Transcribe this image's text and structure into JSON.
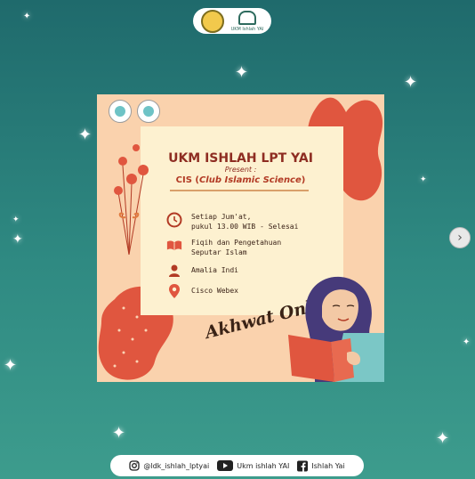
{
  "poster": {
    "title": "UKM ISHLAH LPT YAI",
    "present": "Present :",
    "cis_prefix": "CIS (",
    "cis_italic": "Club Islamic Science",
    "cis_suffix": ")",
    "schedule_line1": "Setiap Jum'at,",
    "schedule_line2": "pukul 13.00 WIB - Selesai",
    "topic_line1": "Fiqih dan Pengetahuan",
    "topic_line2": "Seputar Islam",
    "speaker": "Amalia Indi",
    "location": "Cisco Webex",
    "slogan": "Akhwat Only!"
  },
  "social": {
    "instagram": "@ldk_ishlah_lptyai",
    "youtube": "Ukm ishlah YAI",
    "facebook": "Ishlah Yai"
  },
  "logo_pill": {
    "text": "UKM Ishlah YAI"
  },
  "colors": {
    "primary": "#8e2d22",
    "accent": "#e0563f",
    "background": "#2f8a82",
    "poster_bg": "#fad2ad"
  },
  "icons": [
    "clock-icon",
    "book-icon",
    "person-icon",
    "location-pin-icon",
    "instagram-icon",
    "youtube-icon",
    "facebook-icon",
    "chevron-right-icon"
  ]
}
